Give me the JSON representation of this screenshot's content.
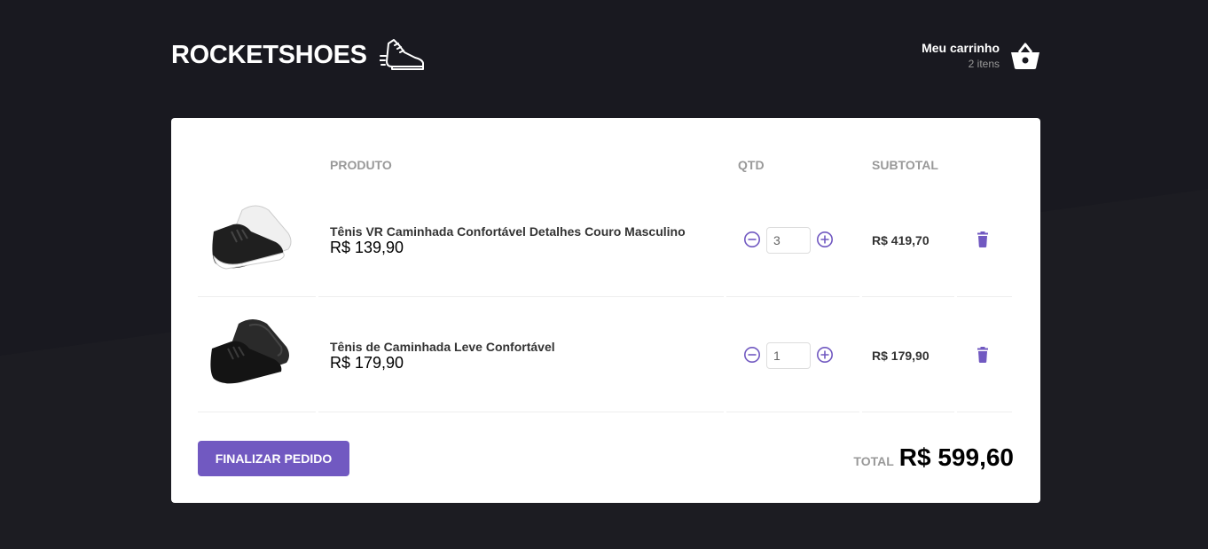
{
  "brand": {
    "name": "ROCKETSHOES"
  },
  "cart": {
    "title": "Meu carrinho",
    "count": "2 itens"
  },
  "table": {
    "headers": {
      "product": "PRODUTO",
      "qty": "QTD",
      "subtotal": "SUBTOTAL"
    },
    "rows": [
      {
        "title": "Tênis VR Caminhada Confortável Detalhes Couro Masculino",
        "price": "R$ 139,90",
        "qty": "3",
        "subtotal": "R$ 419,70",
        "sole_color": "#ffffff"
      },
      {
        "title": "Tênis de Caminhada Leve Confortável",
        "price": "R$ 179,90",
        "qty": "1",
        "subtotal": "R$ 179,90",
        "sole_color": "#1a1a1a"
      }
    ]
  },
  "footer": {
    "button": "FINALIZAR PEDIDO",
    "total_label": "TOTAL",
    "total_value": "R$ 599,60"
  },
  "colors": {
    "accent": "#7159c1",
    "background": "#191920"
  },
  "icons": {
    "logo": "running-shoe-icon",
    "cart": "basket-icon",
    "decrement": "minus-circle-icon",
    "increment": "plus-circle-icon",
    "delete": "trash-icon"
  }
}
